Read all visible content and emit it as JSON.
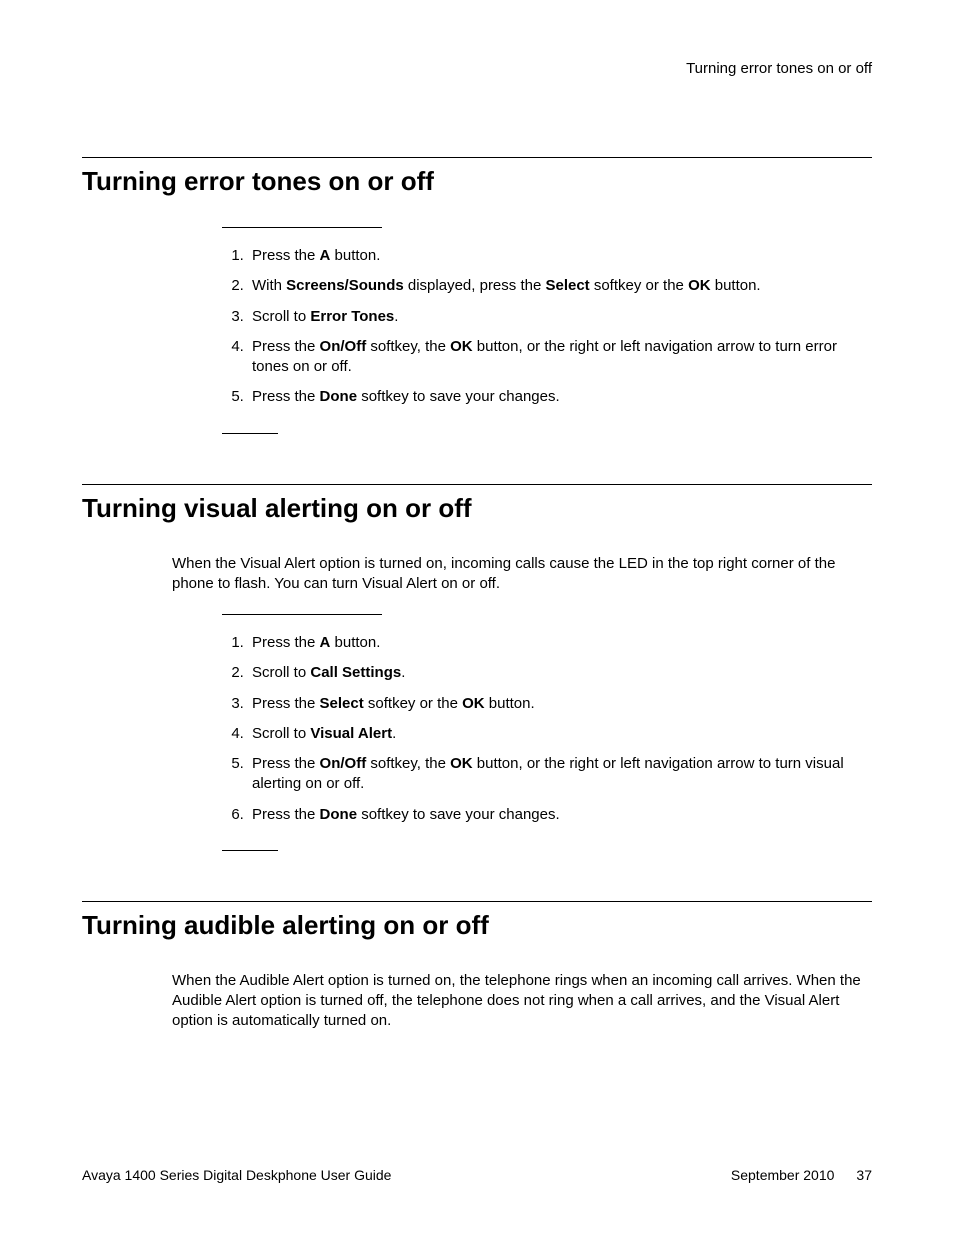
{
  "runningHead": "Turning error tones on or off",
  "sections": [
    {
      "title": "Turning error tones on or off",
      "intro": null,
      "steps": [
        [
          {
            "t": "Press the "
          },
          {
            "b": "A"
          },
          {
            "t": " button."
          }
        ],
        [
          {
            "t": "With "
          },
          {
            "b": "Screens/Sounds"
          },
          {
            "t": " displayed, press the "
          },
          {
            "b": "Select"
          },
          {
            "t": " softkey or the "
          },
          {
            "b": "OK"
          },
          {
            "t": " button."
          }
        ],
        [
          {
            "t": "Scroll to "
          },
          {
            "b": "Error Tones"
          },
          {
            "t": "."
          }
        ],
        [
          {
            "t": "Press the "
          },
          {
            "b": "On/Off"
          },
          {
            "t": " softkey, the "
          },
          {
            "b": "OK"
          },
          {
            "t": " button, or the right or left navigation arrow to turn error tones on or off."
          }
        ],
        [
          {
            "t": "Press the "
          },
          {
            "b": "Done"
          },
          {
            "t": " softkey to save your changes."
          }
        ]
      ]
    },
    {
      "title": "Turning visual alerting on or off",
      "intro": "When the Visual Alert option is turned on, incoming calls cause the LED in the top right corner of the phone to flash. You can turn Visual Alert on or off.",
      "steps": [
        [
          {
            "t": "Press the "
          },
          {
            "b": "A"
          },
          {
            "t": " button."
          }
        ],
        [
          {
            "t": "Scroll to "
          },
          {
            "b": "Call Settings"
          },
          {
            "t": "."
          }
        ],
        [
          {
            "t": "Press the "
          },
          {
            "b": "Select"
          },
          {
            "t": " softkey or the "
          },
          {
            "b": "OK"
          },
          {
            "t": " button."
          }
        ],
        [
          {
            "t": "Scroll to "
          },
          {
            "b": "Visual Alert"
          },
          {
            "t": "."
          }
        ],
        [
          {
            "t": "Press the "
          },
          {
            "b": "On/Off"
          },
          {
            "t": " softkey, the "
          },
          {
            "b": "OK"
          },
          {
            "t": " button, or the right or left navigation arrow to turn visual alerting on or off."
          }
        ],
        [
          {
            "t": "Press the "
          },
          {
            "b": "Done"
          },
          {
            "t": " softkey to save your changes."
          }
        ]
      ]
    },
    {
      "title": "Turning audible alerting on or off",
      "intro": "When the Audible Alert option is turned on, the telephone rings when an incoming call arrives. When the Audible Alert option is turned off, the telephone does not ring when a call arrives, and the Visual Alert option is automatically turned on.",
      "steps": null
    }
  ],
  "footer": {
    "left": "Avaya 1400 Series Digital Deskphone User Guide",
    "date": "September 2010",
    "page": "37"
  }
}
